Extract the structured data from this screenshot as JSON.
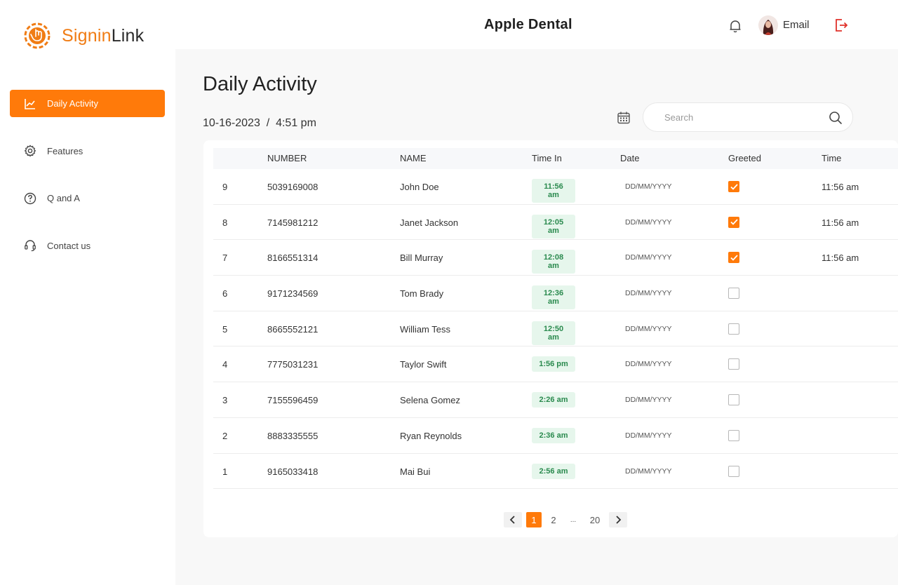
{
  "logo": {
    "part1": "Signin",
    "part2": "Link"
  },
  "sidebar": {
    "items": [
      {
        "label": "Daily Activity",
        "icon": "chart-line-icon",
        "active": true
      },
      {
        "label": "Features",
        "icon": "gear-icon",
        "active": false
      },
      {
        "label": "Q and A",
        "icon": "question-circle-icon",
        "active": false
      },
      {
        "label": "Contact us",
        "icon": "headset-icon",
        "active": false
      }
    ]
  },
  "header": {
    "brand": "Apple Dental",
    "user_label": "Email"
  },
  "page": {
    "title": "Daily Activity",
    "date": "10-16-2023",
    "separator": "/",
    "time": "4:51 pm"
  },
  "search": {
    "placeholder": "Search"
  },
  "table": {
    "columns": [
      "",
      "NUMBER",
      "NAME",
      "Time In",
      "Date",
      "Greeted",
      "Time"
    ],
    "rows": [
      {
        "idx": "9",
        "number": "5039169008",
        "name": "John Doe",
        "time_in": "11:56 am",
        "date": "DD/MM/YYYY",
        "greeted": true,
        "time": "11:56 am"
      },
      {
        "idx": "8",
        "number": "7145981212",
        "name": "Janet Jackson",
        "time_in": "12:05 am",
        "date": "DD/MM/YYYY",
        "greeted": true,
        "time": "11:56 am"
      },
      {
        "idx": "7",
        "number": "8166551314",
        "name": "Bill Murray",
        "time_in": "12:08 am",
        "date": "DD/MM/YYYY",
        "greeted": true,
        "time": "11:56 am"
      },
      {
        "idx": "6",
        "number": "9171234569",
        "name": "Tom Brady",
        "time_in": "12:36 am",
        "date": "DD/MM/YYYY",
        "greeted": false,
        "time": ""
      },
      {
        "idx": "5",
        "number": "8665552121",
        "name": "William Tess",
        "time_in": "12:50 am",
        "date": "DD/MM/YYYY",
        "greeted": false,
        "time": ""
      },
      {
        "idx": "4",
        "number": "7775031231",
        "name": "Taylor Swift",
        "time_in": "1:56 pm",
        "date": "DD/MM/YYYY",
        "greeted": false,
        "time": ""
      },
      {
        "idx": "3",
        "number": "7155596459",
        "name": "Selena Gomez",
        "time_in": "2:26 am",
        "date": "DD/MM/YYYY",
        "greeted": false,
        "time": ""
      },
      {
        "idx": "2",
        "number": "8883335555",
        "name": "Ryan Reynolds",
        "time_in": "2:36 am",
        "date": "DD/MM/YYYY",
        "greeted": false,
        "time": ""
      },
      {
        "idx": "1",
        "number": "9165033418",
        "name": "Mai Bui",
        "time_in": "2:56 am",
        "date": "DD/MM/YYYY",
        "greeted": false,
        "time": ""
      }
    ]
  },
  "pagination": {
    "pages": [
      "1",
      "2",
      "...",
      "20"
    ],
    "current": "1"
  },
  "colors": {
    "accent": "#ff7a0a",
    "pill_bg": "#e6f6ec",
    "pill_text": "#2a8a4e",
    "logout": "#e0322b"
  }
}
